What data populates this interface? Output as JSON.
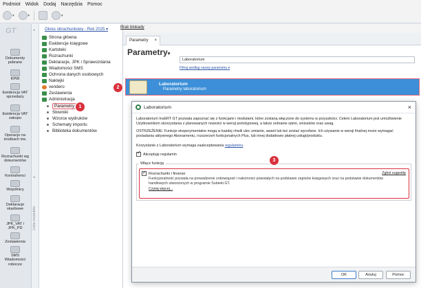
{
  "menu": [
    "Podmiot",
    "Widok",
    "Dodaj",
    "Narzędzia",
    "Pomoc"
  ],
  "leftbar": {
    "items": [
      {
        "label": "Dokumenty pobrane",
        "icon": "documents-icon"
      },
      {
        "label": "KPiR",
        "icon": "book-icon"
      },
      {
        "label": "Ewidencja VAT sprzedaży",
        "icon": "vat-sales-icon"
      },
      {
        "label": "Ewidencja VAT zakupu",
        "icon": "vat-purchase-icon"
      },
      {
        "label": "Operacje na środkach trw.",
        "icon": "fixed-assets-icon"
      },
      {
        "label": "Rozrachunki wg dokumentów",
        "icon": "settlements-icon"
      },
      {
        "label": "Kontrahenci",
        "icon": "contractors-icon"
      },
      {
        "label": "Wspólnicy",
        "icon": "partners-icon"
      },
      {
        "label": "Deklaracje skarbowe",
        "icon": "declarations-icon"
      },
      {
        "label": "JPK_VAT i JPK_PD",
        "icon": "jpk-icon"
      },
      {
        "label": "Zestawienia",
        "icon": "reports-icon"
      },
      {
        "label": "SMS Wiadomości robocze",
        "icon": "sms-icon"
      }
    ],
    "vertical_label": "Lista modułów"
  },
  "tree": {
    "period_link": "Okres obrachunkowy - Rok 2025 ▾",
    "items": [
      {
        "label": "Strona główna",
        "color": "#3a8f4a"
      },
      {
        "label": "Ewidencje księgowe",
        "color": "#3a8f4a"
      },
      {
        "label": "Kartoteki",
        "color": "#3a8f4a"
      },
      {
        "label": "Rozrachunki",
        "color": "#3a8f4a"
      },
      {
        "label": "Deklaracje, JPK i Sprawozdania",
        "color": "#3a8f4a"
      },
      {
        "label": "Wiadomości SMS",
        "color": "#3a8f4a"
      },
      {
        "label": "Ochrona danych osobowych",
        "color": "#3a8f4a"
      },
      {
        "label": "Naklejki",
        "color": "#3a8f4a"
      },
      {
        "label": "vendero",
        "color": "#e07a2a"
      },
      {
        "label": "Zestawienia",
        "color": "#3a8f4a"
      },
      {
        "label": "Administracja",
        "color": "#3a8f4a"
      }
    ],
    "subitems": [
      "Parametry",
      "Słowniki",
      "Wzorce wydruków",
      "Schematy importu",
      "Biblioteka dokumentów"
    ]
  },
  "header": {
    "brak_blokady": "Brak blokady"
  },
  "tab": {
    "label": "Parametry",
    "close": "×"
  },
  "main": {
    "title": "Parametry",
    "search_value": "Laboratorium",
    "filter_link": "Filtruj według nazwy parametru ▾",
    "lab_name": "Laboratorium",
    "lab_desc": "Parametry laboratorium"
  },
  "dialog": {
    "title": "Laboratorium",
    "para1": "Laboratorium InsERT GT pozwala zapoznać się z funkcjami i modułami, które zostaną włączone do systemu w przyszłości. Celem Laboratorium jest umożliwienie Użytkownikom skorzystania z planowanych nowości w wersji prototypowej, a także zebranie opinii, wniosków oraz uwag.",
    "para2": "OSTRZEŻENIE: Funkcje eksperymentalne mogą w każdej chwili ulec zmianie, awarii lub też zostać wycofane. Ich używanie w wersji finalnej może wymagać posiadania aktywnego Abonamentu, rozszerzeń funkcjonalnych Plus, lub innej dodatkowo płatnej usługi/produktu.",
    "para3_prefix": "Korzystanie z Laboratorium wymaga zaakceptowania ",
    "para3_link": "regulaminu",
    "accept_label": "Akceptuję regulamin",
    "functions_legend": "Włącz funkcję",
    "function_name": "Rozrachunki i finanse",
    "report_link": "Zgłoś sugestię",
    "function_desc": "Funkcjonalność pozwala na prowadzenie zobowiązań i należności powstałych na podstawie zapisów księgowych oraz na podstawie dokumentów handlowych utworzonych w programie Subiekt GT.",
    "read_more": "Czytaj więcej...",
    "ok": "OK",
    "cancel": "Anuluj",
    "help": "Pomoc",
    "close": "×"
  },
  "badges": [
    "1",
    "2",
    "3"
  ],
  "colors": {
    "accent": "#3c8fd8",
    "badge": "#d9303c",
    "highlight_border": "#e06a78"
  }
}
